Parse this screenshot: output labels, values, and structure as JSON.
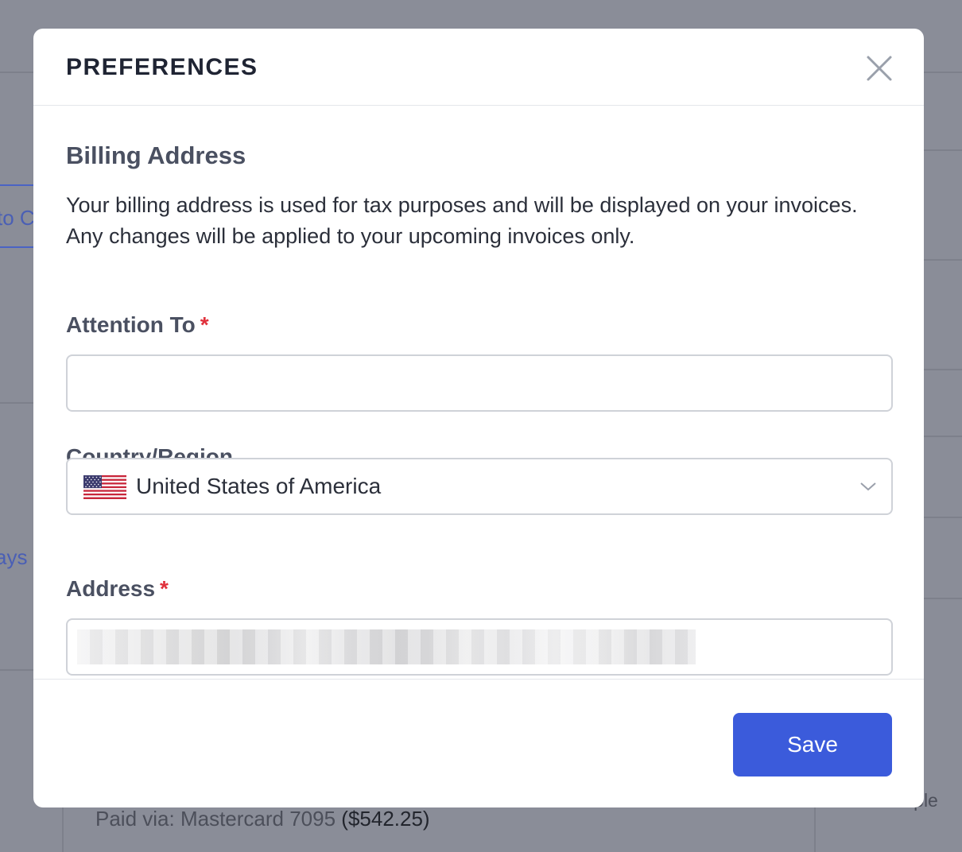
{
  "background": {
    "left_link_1": "to C",
    "left_link_2": "ays",
    "right_text": "mple",
    "paid_via_label": "Paid via: Mastercard 7095",
    "paid_amount": "($542.25)"
  },
  "modal": {
    "title": "PREFERENCES",
    "close_icon": "close-icon",
    "section_title": "Billing Address",
    "description": "Your billing address is used for tax purposes and will be displayed on your invoices. Any changes will be applied to your upcoming invoices only.",
    "attention": {
      "label": "Attention To",
      "required_mark": "*",
      "value": ""
    },
    "country": {
      "label": "Country/Region",
      "value": "United States of America",
      "flag_icon": "us-flag-icon",
      "chevron_icon": "chevron-down-icon"
    },
    "address": {
      "label": "Address",
      "required_mark": "*",
      "value": ""
    },
    "save_label": "Save"
  },
  "colors": {
    "overlay": "#8a8d98",
    "primary_button": "#3b5bdb",
    "required": "#e0313c",
    "title": "#1f2433",
    "label": "#4a5061"
  }
}
